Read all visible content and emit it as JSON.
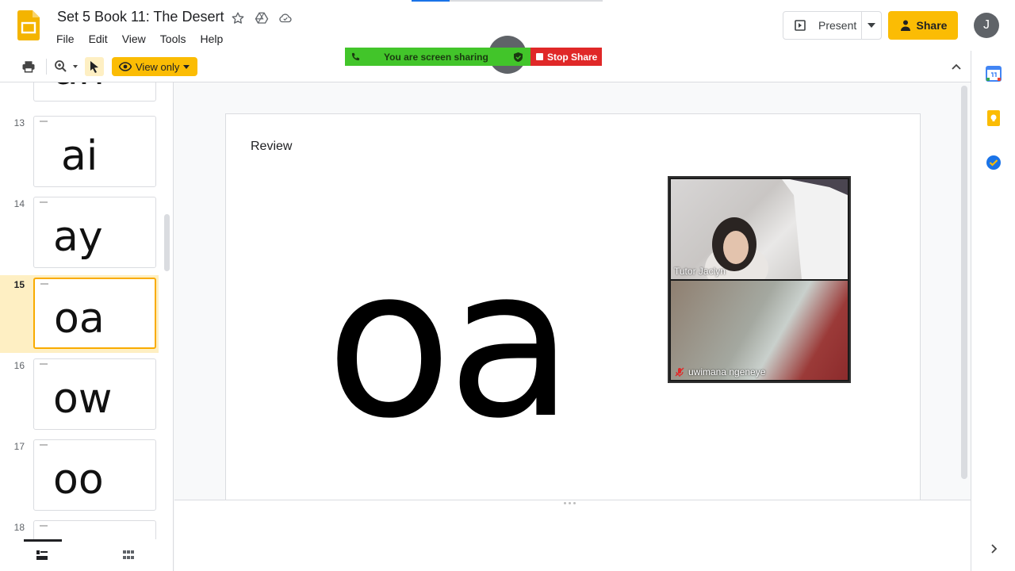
{
  "app": {
    "title": "Set 5 Book 11: The Desert"
  },
  "menu": [
    "File",
    "Edit",
    "View",
    "Tools",
    "Help"
  ],
  "header": {
    "present_label": "Present",
    "share_label": "Share",
    "avatar_letter": "J"
  },
  "toolbar": {
    "view_mode_label": "View only"
  },
  "screen_share": {
    "status_label": "You are screen sharing",
    "stop_label": "Stop Share"
  },
  "filmstrip": {
    "partial_top_text": "ah",
    "slides": [
      {
        "number": "13",
        "text": "ai"
      },
      {
        "number": "14",
        "text": "ay"
      },
      {
        "number": "15",
        "text": "oa",
        "selected": true
      },
      {
        "number": "16",
        "text": "ow"
      },
      {
        "number": "17",
        "text": "oo"
      },
      {
        "number": "18",
        "text": ""
      }
    ]
  },
  "slide": {
    "heading": "Review",
    "main_text": "oa"
  },
  "video": {
    "participants": [
      {
        "name": "Tutor Jaclyn",
        "muted": false
      },
      {
        "name": "uwimana ngeneye",
        "muted": true
      }
    ]
  },
  "colors": {
    "accent": "#fbbc04",
    "selected_bg": "#feefc3",
    "share_green": "#42c52a",
    "stop_red": "#e02828"
  }
}
